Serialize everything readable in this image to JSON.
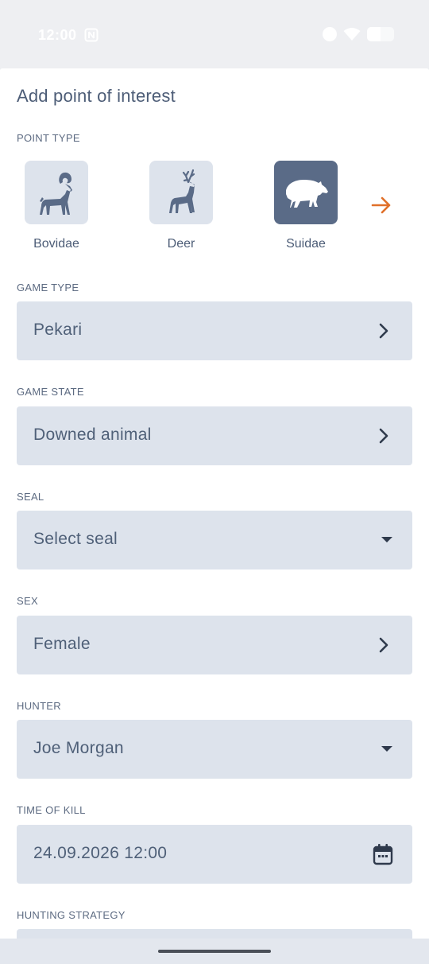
{
  "status_bar": {
    "time": "12:00"
  },
  "sheet": {
    "title": "Add point of interest"
  },
  "point_type": {
    "label": "POINT TYPE",
    "items": [
      {
        "label": "Bovidae",
        "icon": "ram-icon",
        "selected": false
      },
      {
        "label": "Deer",
        "icon": "deer-icon",
        "selected": false
      },
      {
        "label": "Suidae",
        "icon": "boar-icon",
        "selected": true
      }
    ],
    "next_icon": "arrow-right-icon",
    "accent_color": "#e0702a"
  },
  "fields": {
    "game_type": {
      "label": "GAME TYPE",
      "value": "Pekari",
      "control": "chevron-right-icon"
    },
    "game_state": {
      "label": "GAME STATE",
      "value": "Downed animal",
      "control": "chevron-right-icon"
    },
    "seal": {
      "label": "SEAL",
      "value": "Select seal",
      "control": "dropdown-caret-icon"
    },
    "sex": {
      "label": "SEX",
      "value": "Female",
      "control": "chevron-right-icon"
    },
    "hunter": {
      "label": "HUNTER",
      "value": "Joe Morgan",
      "control": "dropdown-caret-icon"
    },
    "time_of_kill": {
      "label": "TIME OF KILL",
      "value": "24.09.2026 12:00",
      "control": "calendar-icon"
    },
    "hunting_strategy": {
      "label": "HUNTING STRATEGY"
    }
  },
  "colors": {
    "field_bg": "#dde3ec",
    "selected_tile_bg": "#5a6b87",
    "text": "#4f6078"
  }
}
